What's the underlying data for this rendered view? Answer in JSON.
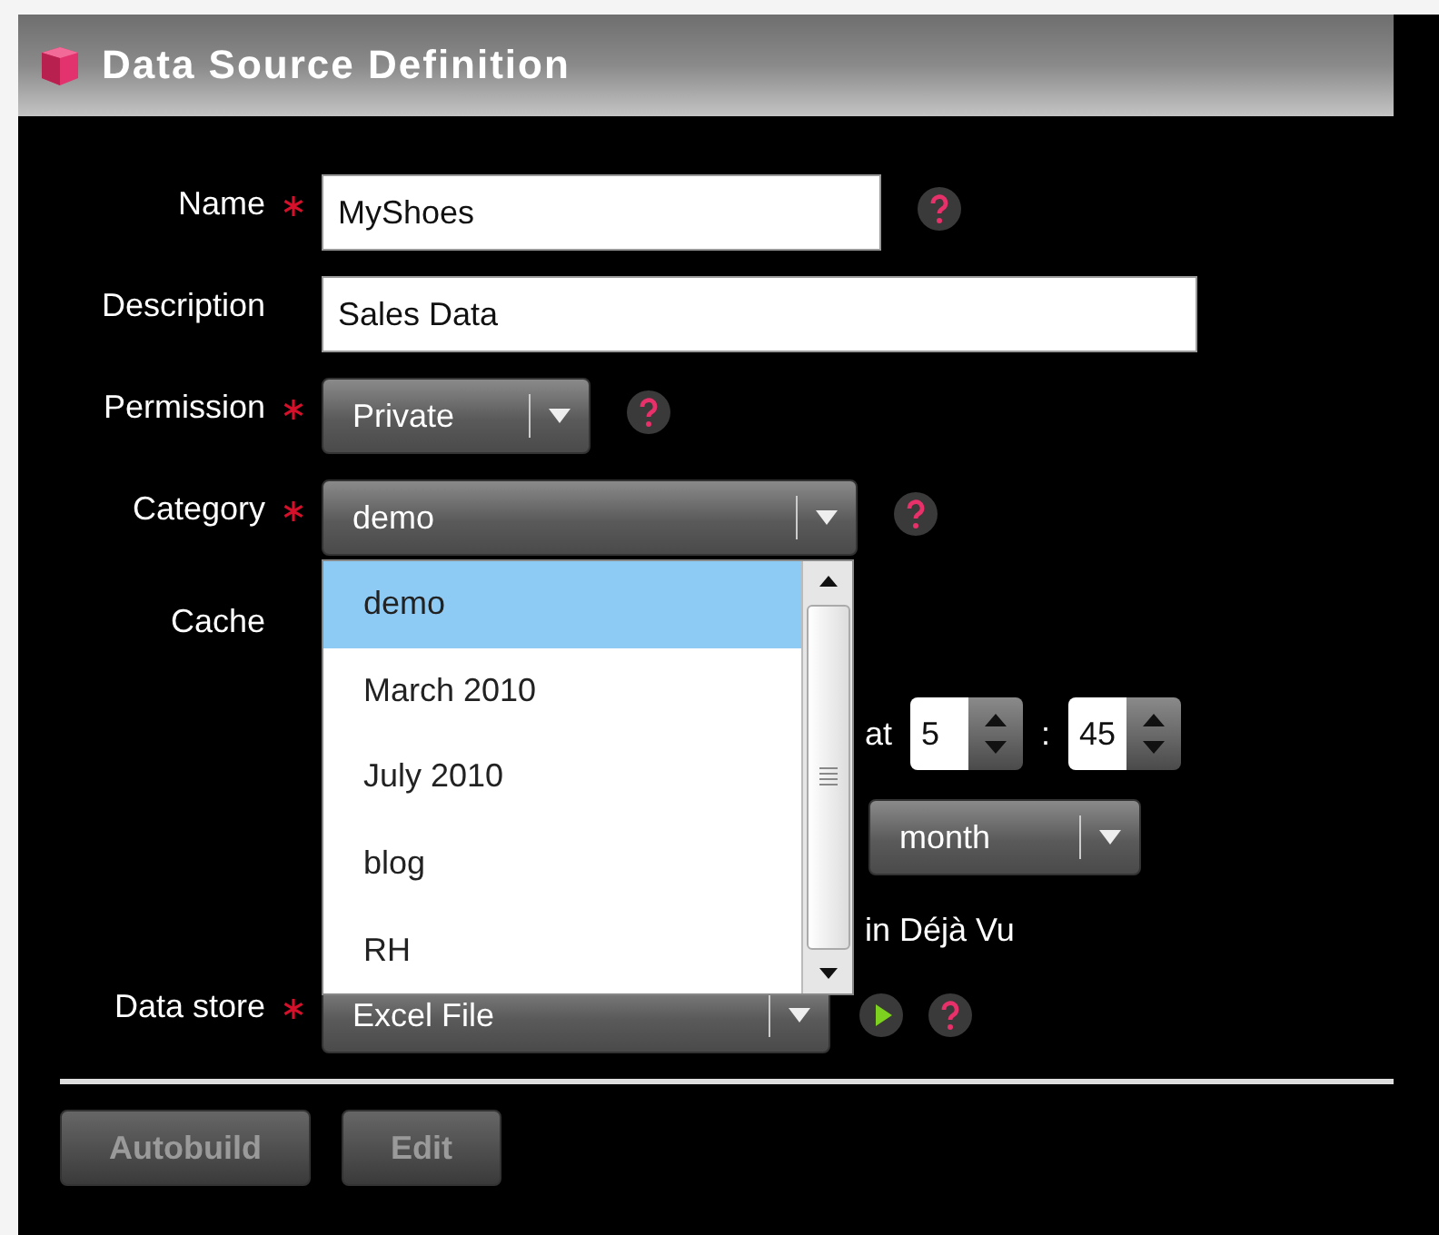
{
  "window": {
    "title": "Data Source Definition"
  },
  "fields": [
    {
      "kind": "text",
      "label": "Name",
      "required": true,
      "value": "MyShoes",
      "help": true
    },
    {
      "kind": "text",
      "label": "Description",
      "required": false,
      "value": "Sales Data",
      "help": false
    },
    {
      "kind": "select",
      "label": "Permission",
      "required": true,
      "value": "Private",
      "help": true
    },
    {
      "kind": "select",
      "label": "Category",
      "required": true,
      "value": "demo",
      "help": true,
      "open": true,
      "options": [
        {
          "label": "demo",
          "selected": true
        },
        {
          "label": "March 2010",
          "selected": false
        },
        {
          "label": "July 2010",
          "selected": false
        },
        {
          "label": "blog",
          "selected": false
        },
        {
          "label": "RH",
          "selected": false
        }
      ]
    }
  ],
  "cache": {
    "label": "Cache",
    "at_label": "at",
    "hour": "5",
    "separator": ":",
    "minute": "45",
    "period": "month",
    "suffix": "in Déjà Vu"
  },
  "data_store": {
    "label": "Data store",
    "required": true,
    "value": "Excel File",
    "help": true
  },
  "buttons": [
    {
      "label": "Autobuild",
      "disabled": true
    },
    {
      "label": "Edit",
      "disabled": true
    }
  ]
}
